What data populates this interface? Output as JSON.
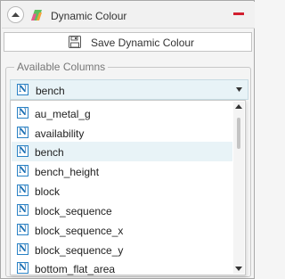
{
  "header": {
    "title": "Dynamic Colour"
  },
  "save_button": {
    "label": "Save Dynamic Colour"
  },
  "available_columns": {
    "label": "Available Columns",
    "selected": "bench",
    "type_icon": "N",
    "items": [
      "au_metal_g",
      "availability",
      "bench",
      "bench_height",
      "block",
      "block_sequence",
      "block_sequence_x",
      "block_sequence_y",
      "bottom_flat_area"
    ]
  },
  "colors": {
    "accent_remove": "#d21f2f",
    "selection": "#e8f3f7",
    "numeric_icon": "#1b6fb3"
  }
}
